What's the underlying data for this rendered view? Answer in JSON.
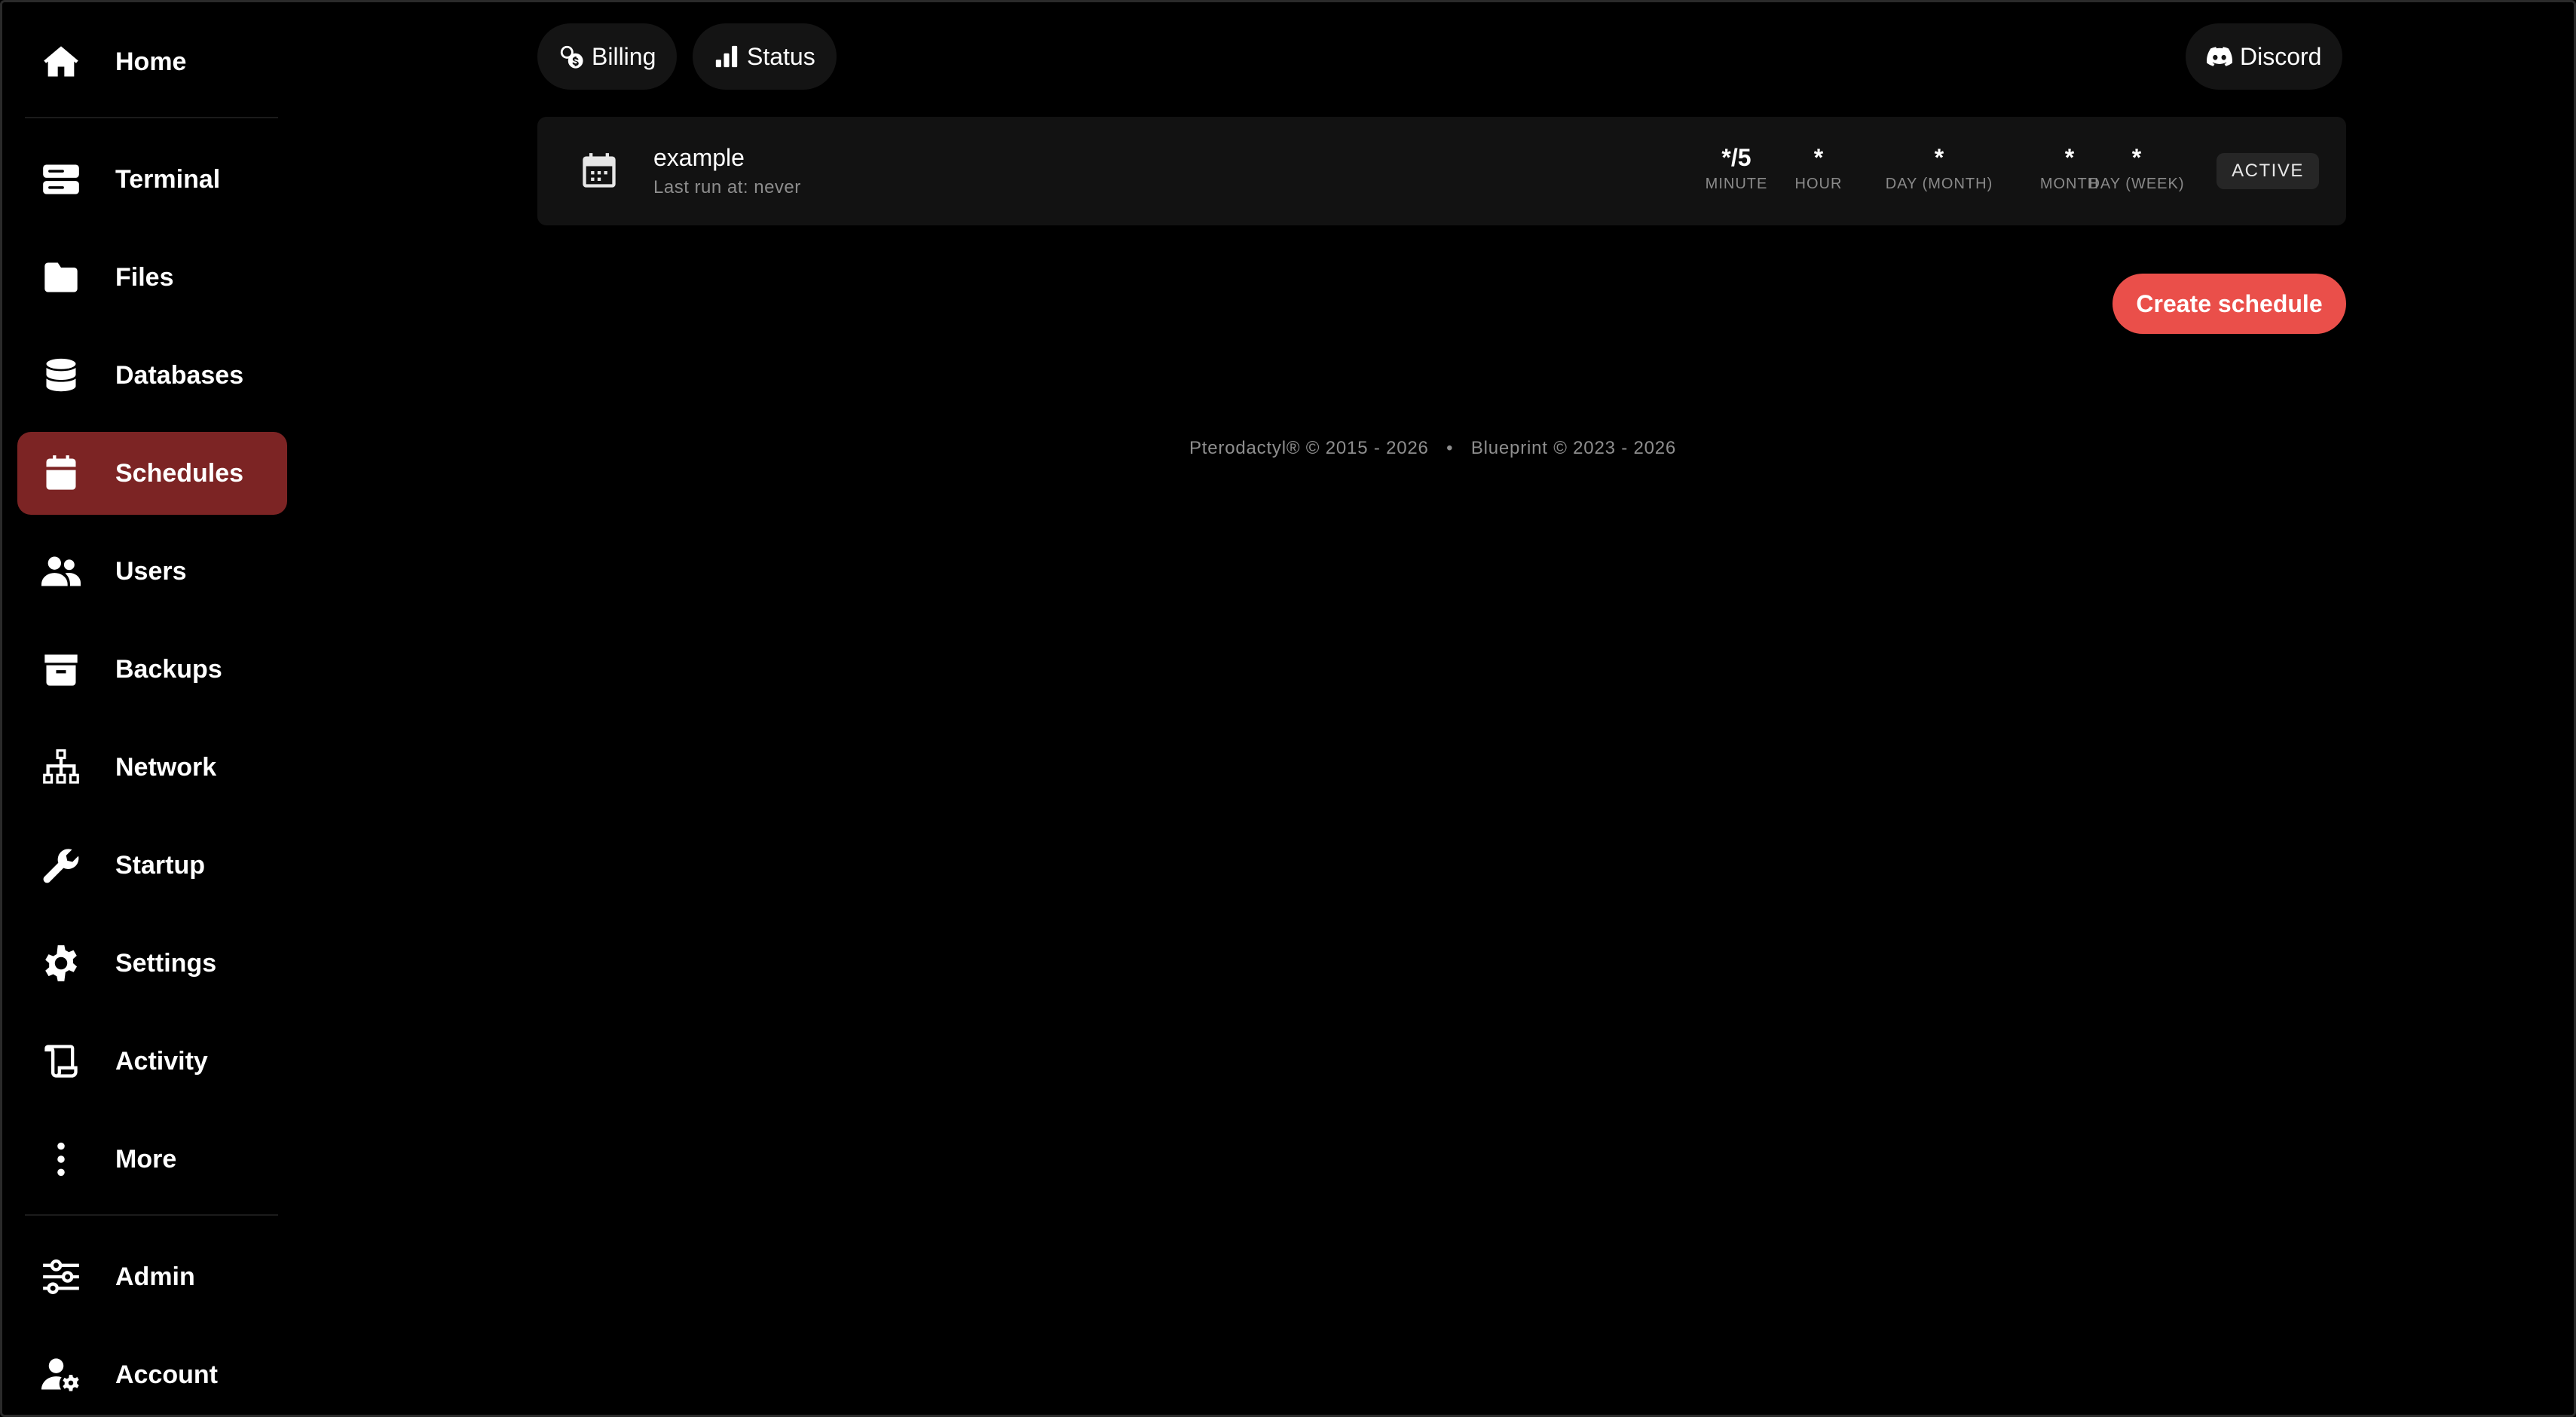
{
  "sidebar": {
    "items": [
      {
        "label": "Home",
        "icon": "home-icon"
      },
      {
        "label": "Terminal",
        "icon": "terminal-icon"
      },
      {
        "label": "Files",
        "icon": "folder-icon"
      },
      {
        "label": "Databases",
        "icon": "database-icon"
      },
      {
        "label": "Schedules",
        "icon": "calendar-icon",
        "active": true
      },
      {
        "label": "Users",
        "icon": "users-icon"
      },
      {
        "label": "Backups",
        "icon": "archive-icon"
      },
      {
        "label": "Network",
        "icon": "network-icon"
      },
      {
        "label": "Startup",
        "icon": "wrench-icon"
      },
      {
        "label": "Settings",
        "icon": "gear-icon"
      },
      {
        "label": "Activity",
        "icon": "scroll-icon"
      },
      {
        "label": "More",
        "icon": "more-vertical-icon"
      },
      {
        "label": "Admin",
        "icon": "sliders-icon"
      },
      {
        "label": "Account",
        "icon": "user-gear-icon"
      }
    ]
  },
  "topbar": {
    "billing": "Billing",
    "status": "Status",
    "discord": "Discord"
  },
  "schedule": {
    "name": "example",
    "last_run": "Last run at: never",
    "cron": [
      {
        "value": "*/5",
        "label": "MINUTE"
      },
      {
        "value": "*",
        "label": "HOUR"
      },
      {
        "value": "*",
        "label": "DAY (MONTH)"
      },
      {
        "value": "*",
        "label": "MONTH"
      },
      {
        "value": "*",
        "label": "DAY (WEEK)"
      }
    ],
    "status": "ACTIVE"
  },
  "actions": {
    "create_schedule": "Create schedule"
  },
  "footer": {
    "pterodactyl": "Pterodactyl® © 2015 - 2026",
    "separator": "•",
    "blueprint": "Blueprint © 2023 - 2026"
  },
  "colors": {
    "accent": "#ea4f4a",
    "active_nav": "#7c2424",
    "background": "#000000",
    "card": "#121212"
  }
}
